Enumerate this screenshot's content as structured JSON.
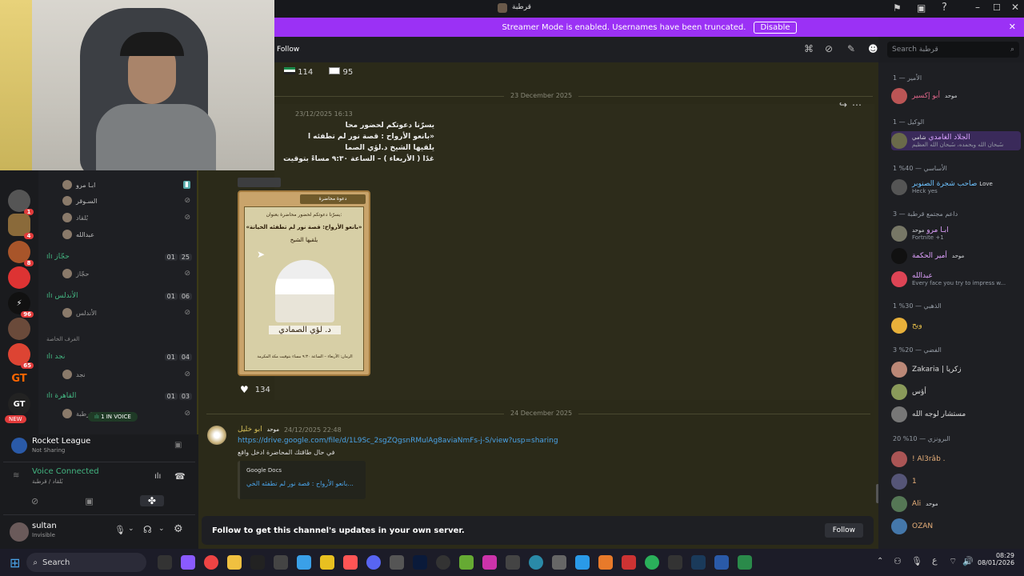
{
  "titlebar": {
    "title": "قرطبة"
  },
  "streamer_banner": {
    "text": "Streamer Mode is enabled. Usernames have been truncated.",
    "button": "Disable"
  },
  "channel_header": {
    "follow": "Follow"
  },
  "search": {
    "placeholder": "Search قرطبة"
  },
  "reactions_top": [
    {
      "count": "114"
    },
    {
      "count": "95"
    }
  ],
  "messages": {
    "date1": "23 December 2025",
    "msg1": {
      "timestamp": "23/12/2025 16:13",
      "lines": [
        "يسرّنا دعوتكم لحضور محا",
        "«بانعو الأرواح : قصة نور لم تطفئه ا",
        "يلقيها الشيخ د.لؤي الصما",
        "غدًا ( الأربعاء ) – الساعة ٩:٣٠ مساءً بتوقيت"
      ],
      "reaction_count": "134",
      "poster": {
        "header": "دعوة محاضرة",
        "line1": "يسرّنا دعوتكم لحضور محاضرة بعنوان:",
        "line2": "«بانعو الأرواح: قصة نور لم تطفئه الخيانة»",
        "line3": "يلقيها الشيخ",
        "name": "د. لؤي الصمادي",
        "footer": "الزمان: الأربعاء – الساعة ٩:٣٠ مساء بتوقيت مكة المكرمة"
      }
    },
    "date2": "24 December 2025",
    "msg2": {
      "author": "ابو خليل",
      "role": "موحد",
      "timestamp": "24/12/2025 22:48",
      "link": "https://drive.google.com/file/d/1L9Sc_2sgZQgsnRMulAg8aviaNmFs-j-S/view?usp=sharing",
      "text": "في حال طاقتك المحاضرة ادخل واقع",
      "embed_site": "Google Docs",
      "embed_title": "بانعو الأرواح : قصة نور لم تطفئه الخي..."
    }
  },
  "follow_bar": {
    "text": "Follow to get this channel's updates in your own server.",
    "button": "Follow"
  },
  "voice_channels": [
    {
      "users": [
        {
          "name": "ابـا مرو"
        },
        {
          "name": "السـوقر"
        },
        {
          "name": "بُلقاد"
        },
        {
          "name": "عبدالله"
        }
      ]
    },
    {
      "name": "حجّاز",
      "count_a": "01",
      "count_b": "25",
      "users": [
        {
          "name": "حجّاز"
        }
      ]
    },
    {
      "name": "الأندلس",
      "count_a": "01",
      "count_b": "06",
      "users": [
        {
          "name": "الأندلس"
        }
      ]
    },
    {
      "category": "الغرف الخاصة"
    },
    {
      "name": "نجد",
      "count_a": "01",
      "count_b": "04",
      "users": [
        {
          "name": "نجد"
        }
      ]
    },
    {
      "name": "القاهرة",
      "count_a": "01",
      "count_b": "03",
      "users": [
        {
          "name": "قرطبة"
        }
      ]
    }
  ],
  "voice_pill": "1 IN VOICE",
  "servers": [
    {
      "badge": "1"
    },
    {
      "badge": "1"
    },
    {
      "badge": "4"
    },
    {
      "badge": "8"
    },
    {
      "badge": ""
    },
    {
      "badge": "96"
    },
    {
      "badge": ""
    },
    {
      "badge": "65"
    },
    {
      "label": "GT"
    },
    {
      "label": "GT",
      "badge": "NEW"
    }
  ],
  "activity": {
    "game": "Rocket League",
    "status": "Not Sharing"
  },
  "voice_status": {
    "title": "Voice Connected",
    "channel": "بُلقاد / قرطبة"
  },
  "user": {
    "name": "sultan",
    "status": "Invisible"
  },
  "members": {
    "groups": [
      {
        "header": "الأمير — 1",
        "members": [
          {
            "name": "أبو إكسير",
            "tag": "موحد"
          }
        ]
      },
      {
        "header": "الوكيل — 1",
        "members": [
          {
            "name": "الجلاد الغامدي",
            "tag": "شامي",
            "sub": "سُبحان الله وبحمده، سُبحان الله العظيم"
          }
        ]
      },
      {
        "header": "الأساسي — 40% 1",
        "members": [
          {
            "name": "صاحب شجرة الصنوبر",
            "tag": "Love",
            "sub": "Heck yes"
          }
        ]
      },
      {
        "header": "داعم مجتمع قرطبة — 3",
        "members": [
          {
            "name": "ابـا مرو",
            "tag": "موحد",
            "sub": "Fortnite +1"
          },
          {
            "name": "أمير الحكمة",
            "tag": "موحد"
          },
          {
            "name": "عبدالله",
            "sub": "Every face you try to impress w..."
          }
        ]
      },
      {
        "header": "الذهبي — 30% 1",
        "members": [
          {
            "name": "ويح"
          }
        ]
      },
      {
        "header": "الفضي — 20% 3",
        "members": [
          {
            "name": "Zakaria | زكريا"
          },
          {
            "name": "أؤس"
          },
          {
            "name": "مستشار لوجه الله"
          }
        ]
      },
      {
        "header": "البرونزي — 10% 20",
        "members": [
          {
            "name": "! Al3râb ."
          },
          {
            "name": "1"
          },
          {
            "name": "Ali",
            "tag": "موحد"
          },
          {
            "name": "OZAN"
          }
        ]
      }
    ]
  },
  "taskbar": {
    "search": "Search",
    "lang": "ع",
    "time": "08:29",
    "date": "08/01/2026"
  }
}
